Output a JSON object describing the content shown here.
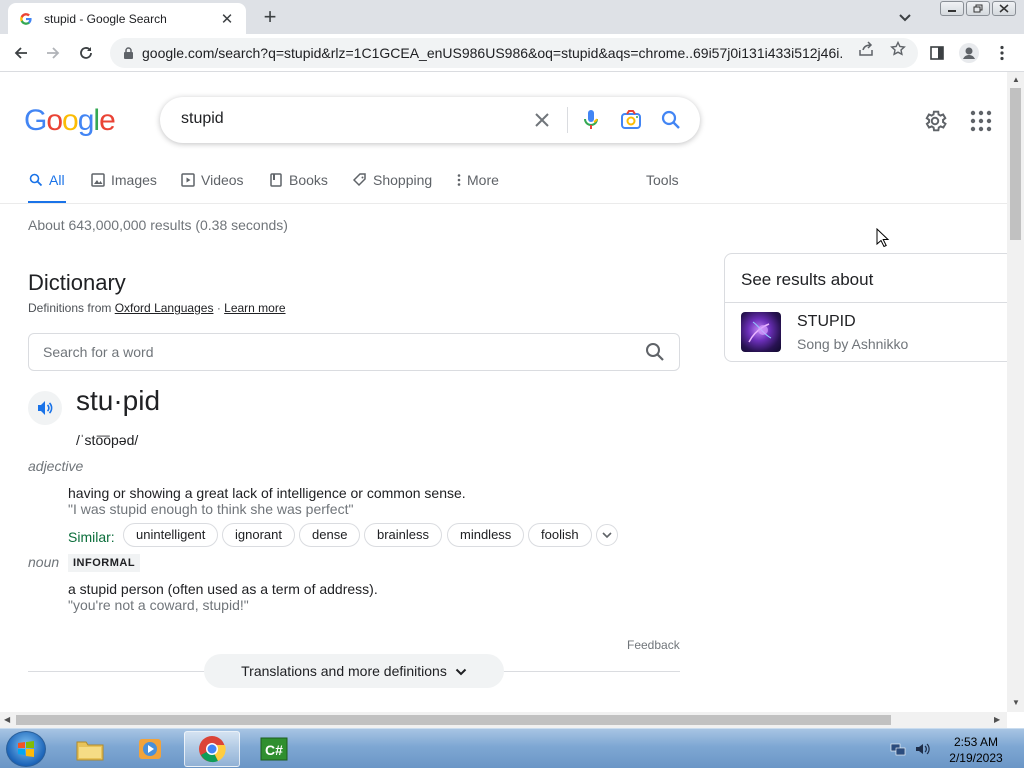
{
  "browser": {
    "tab_title": "stupid - Google Search",
    "url": "google.com/search?q=stupid&rlz=1C1GCEA_enUS986US986&oq=stupid&aqs=chrome..69i57j0i131i433i512j46i..."
  },
  "search": {
    "logo": "Google",
    "query": "stupid"
  },
  "nav_tabs": [
    {
      "label": "All",
      "icon": "search-icon",
      "active": true
    },
    {
      "label": "Images",
      "icon": "image-icon"
    },
    {
      "label": "Videos",
      "icon": "play-icon"
    },
    {
      "label": "Books",
      "icon": "book-icon"
    },
    {
      "label": "Shopping",
      "icon": "tag-icon"
    },
    {
      "label": "More",
      "icon": "kebab-icon"
    }
  ],
  "tools_label": "Tools",
  "result_stats": "About 643,000,000 results (0.38 seconds)",
  "dictionary": {
    "title": "Dictionary",
    "source_prefix": "Definitions from",
    "source_link": "Oxford Languages",
    "separator": "·",
    "learn_more": "Learn more",
    "search_placeholder": "Search for a word",
    "headword": "stu·pid",
    "phonetic": "/ˈsto͞opəd/",
    "senses": [
      {
        "pos": "adjective",
        "definition": "having or showing a great lack of intelligence or common sense.",
        "example": "\"I was stupid enough to think she was perfect\"",
        "similar_label": "Similar:",
        "similar": [
          "unintelligent",
          "ignorant",
          "dense",
          "brainless",
          "mindless",
          "foolish"
        ]
      },
      {
        "pos": "noun",
        "register": "INFORMAL",
        "definition": "a stupid person (often used as a term of address).",
        "example": "\"you're not a coward, stupid!\""
      }
    ],
    "feedback": "Feedback",
    "more_definitions": "Translations and more definitions"
  },
  "side_panel": {
    "header": "See results about",
    "entity_title": "STUPID",
    "entity_subtitle": "Song by Ashnikko"
  },
  "taskbar": {
    "time": "2:53 AM",
    "date": "2/19/2023"
  },
  "colors": {
    "google_blue": "#4285f4",
    "google_red": "#ea4335",
    "google_yellow": "#fbbc05",
    "google_green": "#34a853",
    "link_blue": "#1a73e8",
    "similar_green": "#0b6e3b"
  }
}
